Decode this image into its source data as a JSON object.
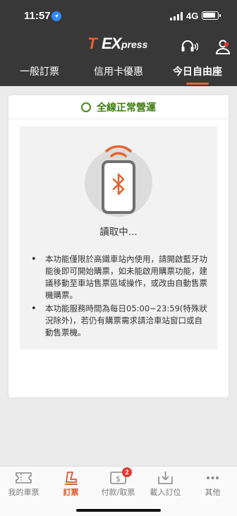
{
  "status_bar": {
    "time": "11:57",
    "network": "4G"
  },
  "header": {
    "logo": {
      "t": "T",
      "ex": "EX",
      "press": "press"
    },
    "tabs": [
      {
        "label": "一般訂票"
      },
      {
        "label": "信用卡優惠"
      },
      {
        "label": "今日自由座"
      }
    ],
    "active_tab": 2
  },
  "main": {
    "status_text": "全線正常營運",
    "reading_text": "讀取中...",
    "notes": [
      "本功能僅限於高鐵車站內使用，請開啟藍牙功能後即可開始購票，如未能啟用購票功能，建議移動至車站售票區域操作，或改由自動售票機購票。",
      "本功能服務時間為每日05:00~23:59(特殊狀況除外)，若仍有購票需求請洽車站窗口或自動售票機。"
    ]
  },
  "bottom_nav": {
    "items": [
      {
        "label": "我的車票",
        "icon": "ticket-icon"
      },
      {
        "label": "訂票",
        "icon": "seat-icon"
      },
      {
        "label": "付款/取票",
        "icon": "payment-icon",
        "badge": "2"
      },
      {
        "label": "載入訂位",
        "icon": "download-icon"
      },
      {
        "label": "其他",
        "icon": "more-icon"
      }
    ],
    "active": 1
  },
  "colors": {
    "accent": "#e8622c",
    "status_ok": "#3e7d13",
    "header_bg": "#383838",
    "badge": "#e53a2f"
  }
}
